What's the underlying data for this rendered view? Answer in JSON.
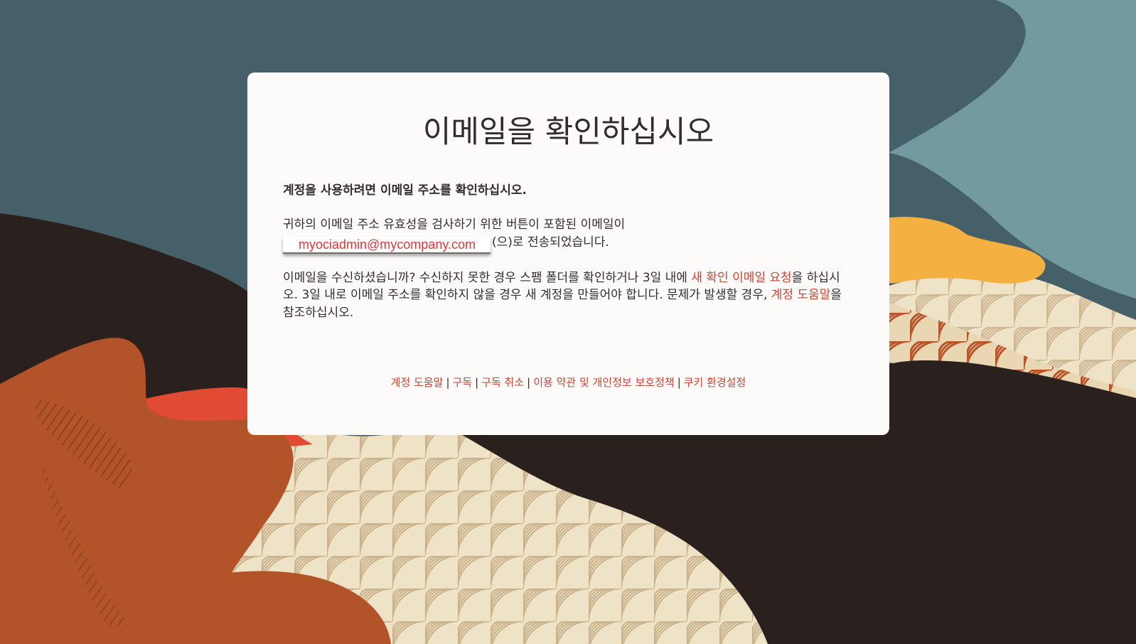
{
  "page": {
    "title": "이메일을 확인하십시오",
    "subtitle": "계정을 사용하려면 이메일 주소를 확인하십시오.",
    "sent_text_line1": "귀하의 이메일 주소 유효성을 검사하기 위한 버튼이 포함된 이메일이",
    "email_address": "myociadmin@mycompany.com",
    "sent_text_suffix": "(으)로 전송되었습니다.",
    "received_text_part1": "이메일을 수신하셨습니까? 수신하지 못한 경우 스팸 폴더를 확인하거나 3일 내에 ",
    "request_link": "새 확인 이메일 요청",
    "received_text_part2": "을 하십시오. 3일 내로 이메일 주소를 확인하지 않을 경우 새 계정을 만들어야 합니다. 문제가 발생할 경우, ",
    "help_link": "계정 도움말",
    "received_text_part3": "을 참조하십시오."
  },
  "footer": {
    "links": [
      {
        "label": "계정 도움말"
      },
      {
        "label": "구독"
      },
      {
        "label": "구독 취소"
      },
      {
        "label": "이용 약관 및 개인정보 보호정책"
      },
      {
        "label": "쿠키 환경설정"
      }
    ],
    "separator": "|"
  },
  "colors": {
    "link": "#c74634",
    "text": "#312d2a",
    "email_highlight": "#d8393a",
    "card_background": "#fcfbfa"
  }
}
